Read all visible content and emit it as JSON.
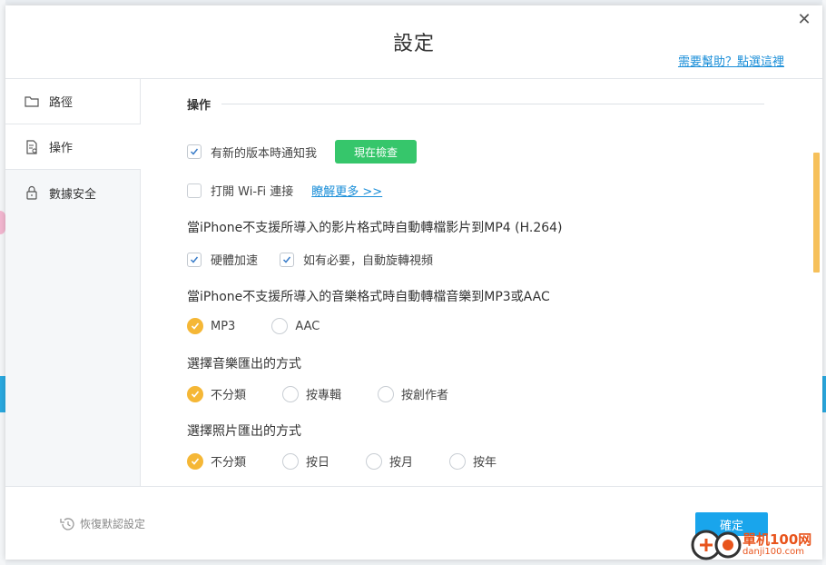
{
  "dialog": {
    "title": "設定",
    "help_link": "需要幫助？點選這裡",
    "close_icon": "close-icon"
  },
  "sidebar": {
    "items": [
      {
        "label": "路徑",
        "icon": "folder-icon"
      },
      {
        "label": "操作",
        "icon": "document-settings-icon"
      },
      {
        "label": "數據安全",
        "icon": "lock-icon"
      }
    ],
    "active": "操作"
  },
  "content": {
    "section_title": "操作",
    "update": {
      "label": "有新的版本時通知我",
      "checked": true,
      "button": "現在檢查"
    },
    "wifi": {
      "label": "打開 Wi-Fi 連接",
      "checked": false,
      "link": "瞭解更多 >>"
    },
    "video": {
      "heading": "當iPhone不支援所導入的影片格式時自動轉檔影片到MP4 (H.264)",
      "options": [
        {
          "label": "硬體加速",
          "checked": true
        },
        {
          "label": "如有必要，自動旋轉視頻",
          "checked": true
        }
      ]
    },
    "music_convert": {
      "heading": "當iPhone不支援所導入的音樂格式時自動轉檔音樂到MP3或AAC",
      "options": [
        {
          "label": "MP3",
          "selected": true
        },
        {
          "label": "AAC",
          "selected": false
        }
      ]
    },
    "music_export": {
      "heading": "選擇音樂匯出的方式",
      "options": [
        {
          "label": "不分類",
          "selected": true
        },
        {
          "label": "按專輯",
          "selected": false
        },
        {
          "label": "按創作者",
          "selected": false
        }
      ]
    },
    "photo_export": {
      "heading": "選擇照片匯出的方式",
      "options": [
        {
          "label": "不分類",
          "selected": true
        },
        {
          "label": "按日",
          "selected": false
        },
        {
          "label": "按月",
          "selected": false
        },
        {
          "label": "按年",
          "selected": false
        }
      ]
    }
  },
  "footer": {
    "restore_label": "恢復默認設定",
    "confirm_label": "確定"
  },
  "watermark": {
    "text1": "單机100网",
    "text2": "danji100.com"
  },
  "colors": {
    "accent_green": "#36c66b",
    "accent_blue": "#19a5ec",
    "radio_selected": "#f5b736",
    "link": "#1a8ed8"
  }
}
